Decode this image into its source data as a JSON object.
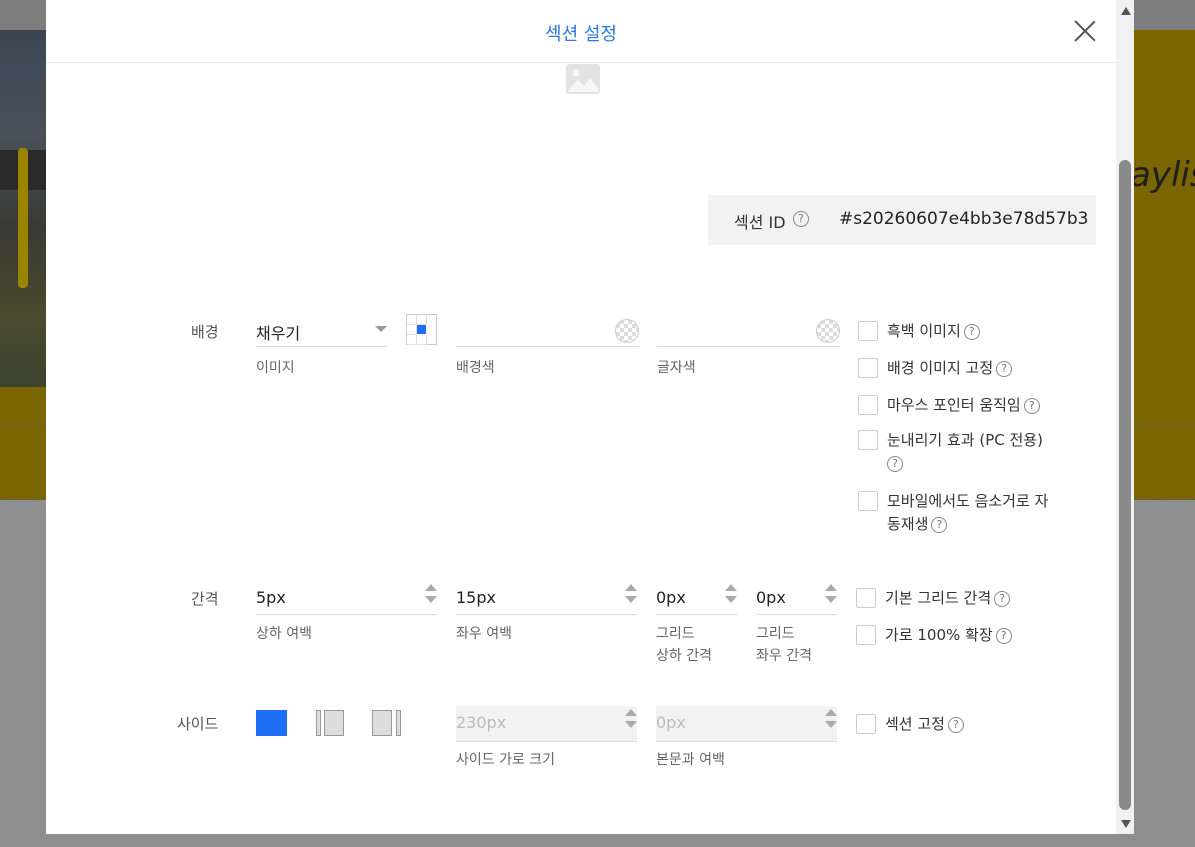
{
  "background": {
    "partial_text": "aylis"
  },
  "modal": {
    "title": "섹션 설정",
    "section_id": {
      "label": "섹션 ID",
      "value": "#s20260607e4bb3e78d57b3"
    },
    "background_row": {
      "label": "배경",
      "fill_mode": "채우기",
      "image_label": "이미지",
      "bg_color_label": "배경색",
      "text_color_label": "글자색",
      "checkboxes": [
        {
          "label": "흑백 이미지",
          "checked": false
        },
        {
          "label": "배경 이미지 고정",
          "checked": false
        },
        {
          "label": "마우스 포인터 움직임",
          "checked": false
        },
        {
          "label": "눈내리기 효과 (PC 전용)",
          "checked": false
        },
        {
          "label_line1": "모바일에서도 음소거로 자",
          "label_line2": "동재생",
          "checked": false
        }
      ]
    },
    "spacing_row": {
      "label": "간격",
      "vertical_padding": {
        "value": "5px",
        "label": "상하 여백"
      },
      "horizontal_padding": {
        "value": "15px",
        "label": "좌우 여백"
      },
      "grid_vertical": {
        "value": "0px",
        "label_line1": "그리드",
        "label_line2": "상하 간격"
      },
      "grid_horizontal": {
        "value": "0px",
        "label_line1": "그리드",
        "label_line2": "좌우 간격"
      },
      "checkboxes": [
        {
          "label": "기본 그리드 간격",
          "checked": false
        },
        {
          "label": "가로 100% 확장",
          "checked": false
        }
      ]
    },
    "side_row": {
      "label": "사이드",
      "side_width": {
        "value": "230px",
        "label": "사이드 가로 크기"
      },
      "body_margin": {
        "value": "0px",
        "label": "본문과 여백"
      },
      "checkboxes": [
        {
          "label": "섹션 고정",
          "checked": false
        }
      ]
    },
    "help_glyph": "?"
  },
  "colors": {
    "accent": "#1e6ff5",
    "title": "#2b78e4"
  },
  "icons": [
    "close-icon",
    "image-placeholder-icon",
    "help-icon",
    "dropdown-arrow-icon",
    "stepper-icon",
    "color-picker-icon",
    "grid-position-icon",
    "scroll-up-icon",
    "scroll-down-icon"
  ]
}
